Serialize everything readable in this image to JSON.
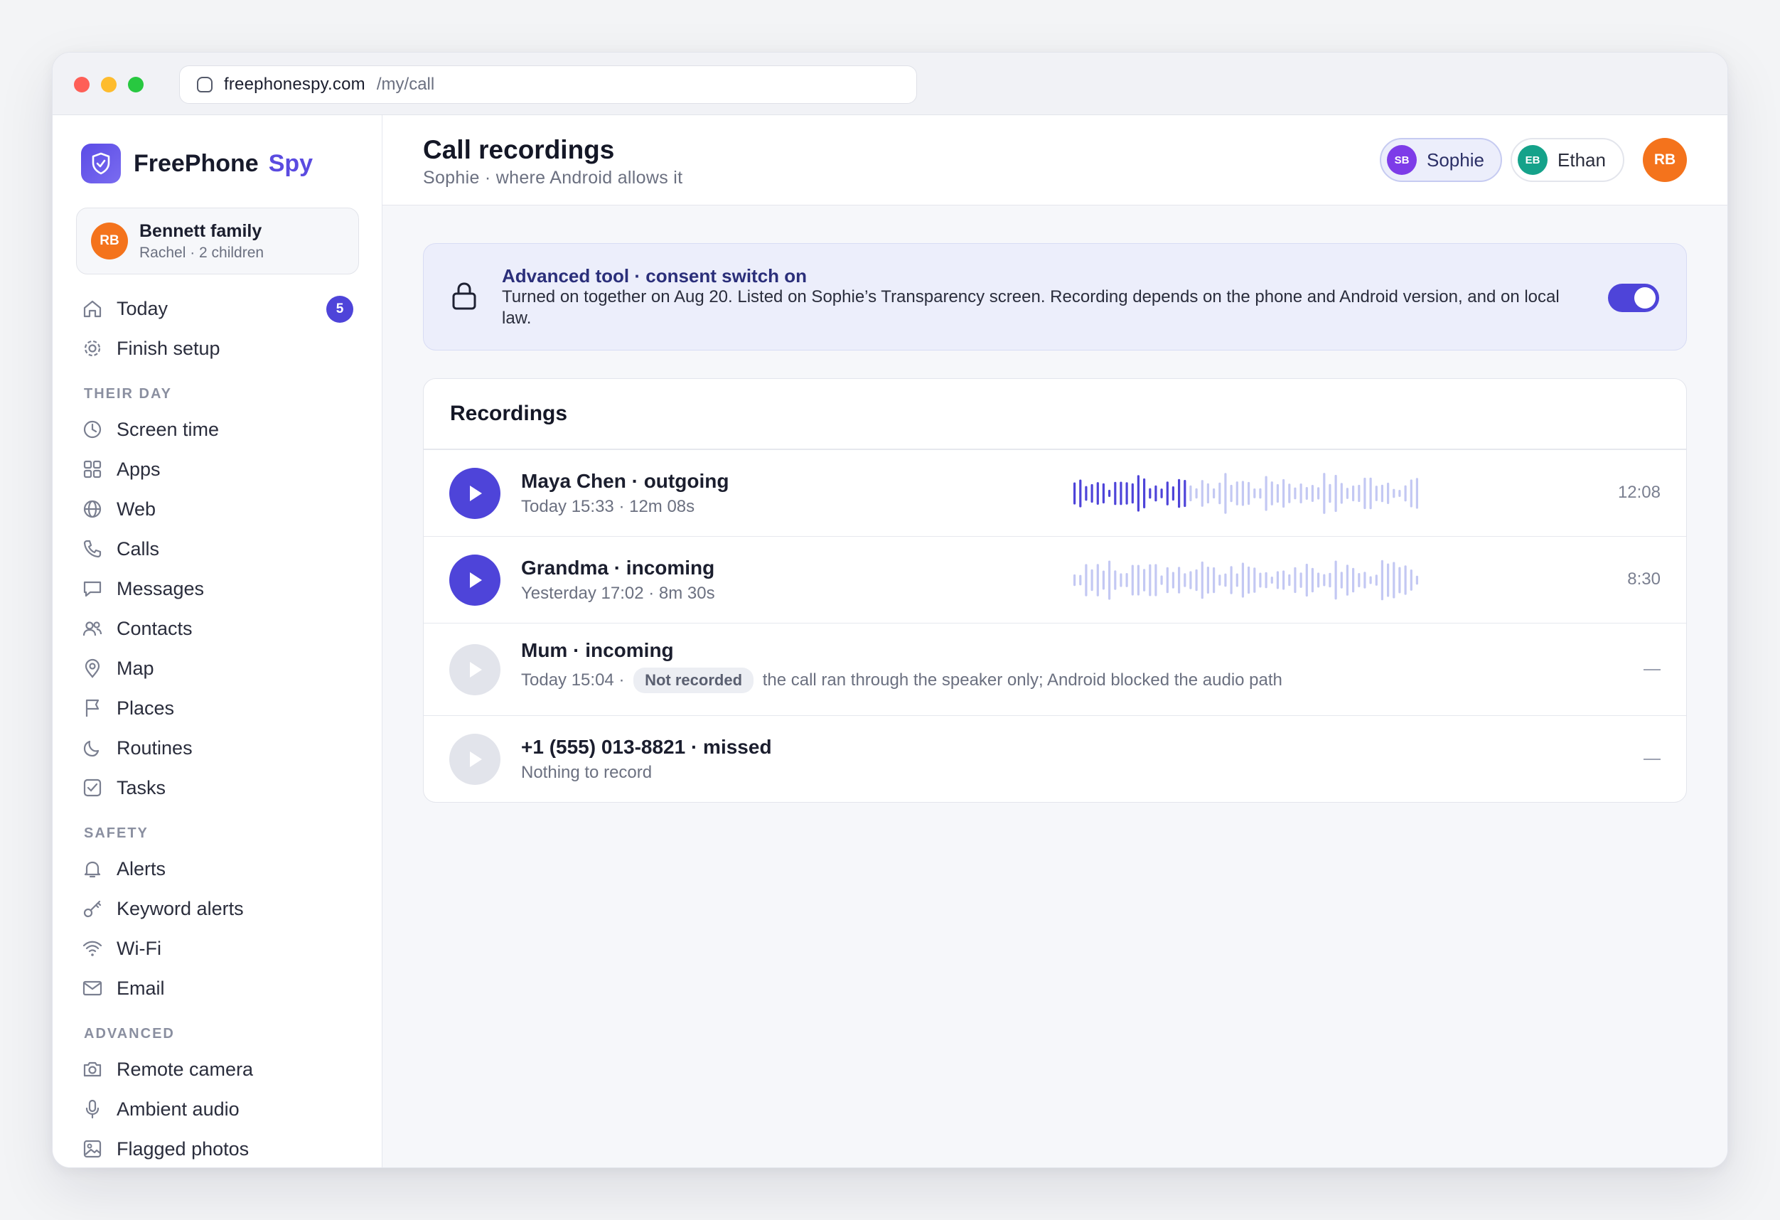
{
  "browser": {
    "domain": "freephonespy.com",
    "path": "/my/call"
  },
  "sidebar": {
    "brand": {
      "name": "FreePhone",
      "accent": "Spy"
    },
    "family": {
      "avatar": "RB",
      "name": "Bennett family",
      "sub": "Rachel · 2 children"
    },
    "top_items": [
      {
        "label": "Today",
        "icon": "home-icon",
        "badge": "5"
      },
      {
        "label": "Finish setup",
        "icon": "gear-icon"
      }
    ],
    "sections": [
      {
        "title": "THEIR DAY",
        "items": [
          {
            "label": "Screen time",
            "icon": "clock-icon"
          },
          {
            "label": "Apps",
            "icon": "grid-icon"
          },
          {
            "label": "Web",
            "icon": "globe-icon"
          },
          {
            "label": "Calls",
            "icon": "phone-icon"
          },
          {
            "label": "Messages",
            "icon": "message-icon"
          },
          {
            "label": "Contacts",
            "icon": "contacts-icon"
          },
          {
            "label": "Map",
            "icon": "map-pin-icon"
          },
          {
            "label": "Places",
            "icon": "flag-icon"
          },
          {
            "label": "Routines",
            "icon": "moon-icon"
          },
          {
            "label": "Tasks",
            "icon": "checkbox-icon"
          }
        ]
      },
      {
        "title": "SAFETY",
        "items": [
          {
            "label": "Alerts",
            "icon": "bell-icon"
          },
          {
            "label": "Keyword alerts",
            "icon": "key-icon"
          },
          {
            "label": "Wi-Fi",
            "icon": "wifi-icon"
          },
          {
            "label": "Email",
            "icon": "mail-icon"
          }
        ]
      },
      {
        "title": "ADVANCED",
        "items": [
          {
            "label": "Remote camera",
            "icon": "camera-icon"
          },
          {
            "label": "Ambient audio",
            "icon": "microphone-icon"
          },
          {
            "label": "Flagged photos",
            "icon": "image-icon"
          }
        ]
      }
    ]
  },
  "header": {
    "title": "Call recordings",
    "subtitle": "Sophie · where Android allows it",
    "children": [
      {
        "initials": "SB",
        "name": "Sophie",
        "selected": true,
        "color": "#7d3ce8"
      },
      {
        "initials": "EB",
        "name": "Ethan",
        "selected": false,
        "color": "#15a28a"
      }
    ],
    "user_avatar": "RB"
  },
  "consent": {
    "title": "Advanced tool · consent switch on",
    "text": "Turned on together on Aug 20. Listed on Sophie’s Transparency screen. Recording depends on the phone and Android version, and on local law.",
    "toggle_on": true
  },
  "recordings": {
    "title": "Recordings",
    "rows": [
      {
        "title": "Maya Chen · outgoing",
        "sub": "Today 15:33 · 12m 08s",
        "duration": "12:08",
        "playable": true,
        "waveform": true,
        "progress": 0.32
      },
      {
        "title": "Grandma · incoming",
        "sub": "Yesterday 17:02 · 8m 30s",
        "duration": "8:30",
        "playable": true,
        "waveform": true,
        "progress": 0
      },
      {
        "title": "Mum · incoming",
        "sub_prefix": "Today 15:04 ·",
        "pill": "Not recorded",
        "sub_suffix": "the call ran through the speaker only; Android blocked the audio path",
        "duration": "—",
        "playable": false,
        "waveform": false
      },
      {
        "title": "+1 (555) 013-8821 · missed",
        "sub": "Nothing to record",
        "duration": "—",
        "playable": false,
        "waveform": false
      }
    ]
  },
  "colors": {
    "accent": "#4e44d9",
    "wave_played": "#4e44d9",
    "wave_unplayed": "#c3c8f3",
    "orange": "#f4731c"
  }
}
